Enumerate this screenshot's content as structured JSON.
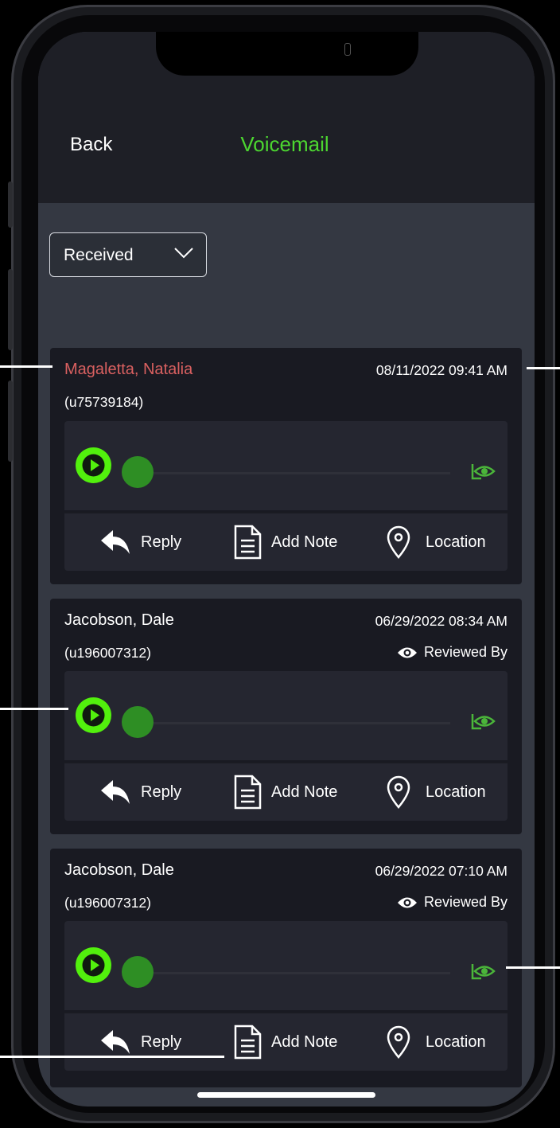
{
  "header": {
    "back_label": "Back",
    "title": "Voicemail",
    "title_color": "#4cd630"
  },
  "filter": {
    "selected": "Received"
  },
  "voicemails": [
    {
      "name": "Magaletta, Natalia",
      "unread": true,
      "timestamp": "08/11/2022 09:41 AM",
      "user_id": "(u75739184)",
      "reviewed_label": ""
    },
    {
      "name": "Jacobson, Dale",
      "unread": false,
      "timestamp": "06/29/2022 08:34 AM",
      "user_id": "(u196007312)",
      "reviewed_label": "Reviewed By"
    },
    {
      "name": "Jacobson, Dale",
      "unread": false,
      "timestamp": "06/29/2022 07:10 AM",
      "user_id": "(u196007312)",
      "reviewed_label": "Reviewed By"
    }
  ],
  "actions": {
    "reply_label": "Reply",
    "add_note_label": "Add Note",
    "location_label": "Location"
  },
  "icons": {
    "play": "play-icon",
    "seen": "seen-eye-icon",
    "reply": "reply-arrow-icon",
    "note": "document-icon",
    "location": "map-pin-icon",
    "reviewed": "eye-icon",
    "dropdown": "chevron-down-icon"
  },
  "colors": {
    "accent_green": "#52f00d",
    "unread_red": "#d96060",
    "card_bg": "#191a22",
    "screen_bg": "#343842"
  }
}
